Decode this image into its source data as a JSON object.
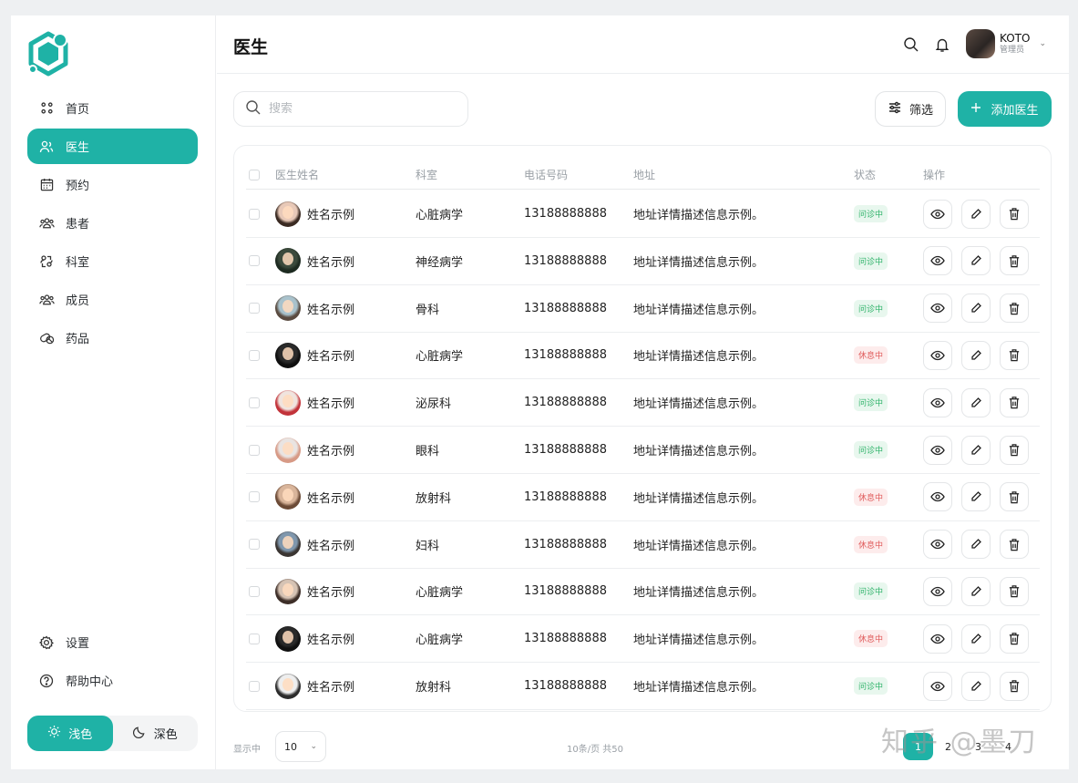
{
  "colors": {
    "accent": "#1fb2a6",
    "status_ok": "#2fb36a",
    "status_rest": "#e05a5a"
  },
  "sidebar": {
    "logo_icon": "hexagon-logo-icon",
    "items": [
      {
        "label": "首页",
        "icon": "grid-dots-icon",
        "active": false
      },
      {
        "label": "医生",
        "icon": "users-icon",
        "active": true
      },
      {
        "label": "预约",
        "icon": "calendar-icon",
        "active": false
      },
      {
        "label": "患者",
        "icon": "group-icon",
        "active": false
      },
      {
        "label": "科室",
        "icon": "refresh-people-icon",
        "active": false
      },
      {
        "label": "成员",
        "icon": "group-icon",
        "active": false
      },
      {
        "label": "药品",
        "icon": "pill-icon",
        "active": false
      }
    ],
    "bottom": [
      {
        "label": "设置",
        "icon": "gear-icon"
      },
      {
        "label": "帮助中心",
        "icon": "help-icon"
      }
    ],
    "theme": {
      "light": "浅色",
      "dark": "深色"
    }
  },
  "header": {
    "title": "医生",
    "user": {
      "name": "KOTO",
      "role": "管理员"
    }
  },
  "toolbar": {
    "search_placeholder": "搜索",
    "filter_label": "筛选",
    "add_label": "添加医生"
  },
  "table": {
    "columns": {
      "name": "医生姓名",
      "dept": "科室",
      "phone": "电话号码",
      "address": "地址",
      "status": "状态",
      "ops": "操作"
    },
    "rows": [
      {
        "name": "姓名示例",
        "dept": "心脏病学",
        "phone": "13188888888",
        "address": "地址详情描述信息示例。",
        "status": "问诊中",
        "status_type": "ok",
        "avatar": [
          "#e8c9b8",
          "#3a2a22"
        ]
      },
      {
        "name": "姓名示例",
        "dept": "神经病学",
        "phone": "13188888888",
        "address": "地址详情描述信息示例。",
        "status": "问诊中",
        "status_type": "ok",
        "avatar": [
          "#3b4a3c",
          "#1d2a20"
        ]
      },
      {
        "name": "姓名示例",
        "dept": "骨科",
        "phone": "13188888888",
        "address": "地址详情描述信息示例。",
        "status": "问诊中",
        "status_type": "ok",
        "avatar": [
          "#a9c2cc",
          "#5a4b40"
        ]
      },
      {
        "name": "姓名示例",
        "dept": "心脏病学",
        "phone": "13188888888",
        "address": "地址详情描述信息示例。",
        "status": "休息中",
        "status_type": "rest",
        "avatar": [
          "#2a2a2a",
          "#0f0f0f"
        ]
      },
      {
        "name": "姓名示例",
        "dept": "泌尿科",
        "phone": "13188888888",
        "address": "地址详情描述信息示例。",
        "status": "问诊中",
        "status_type": "ok",
        "avatar": [
          "#f0e4de",
          "#c2333a"
        ]
      },
      {
        "name": "姓名示例",
        "dept": "眼科",
        "phone": "13188888888",
        "address": "地址详情描述信息示例。",
        "status": "问诊中",
        "status_type": "ok",
        "avatar": [
          "#e9e4e2",
          "#d79a86"
        ]
      },
      {
        "name": "姓名示例",
        "dept": "放射科",
        "phone": "13188888888",
        "address": "地址详情描述信息示例。",
        "status": "休息中",
        "status_type": "rest",
        "avatar": [
          "#d9b59b",
          "#6b4a36"
        ]
      },
      {
        "name": "姓名示例",
        "dept": "妇科",
        "phone": "13188888888",
        "address": "地址详情描述信息示例。",
        "status": "休息中",
        "status_type": "rest",
        "avatar": [
          "#7f97ad",
          "#3a3532"
        ]
      },
      {
        "name": "姓名示例",
        "dept": "心脏病学",
        "phone": "13188888888",
        "address": "地址详情描述信息示例。",
        "status": "问诊中",
        "status_type": "ok",
        "avatar": [
          "#d6c3b4",
          "#3d2e28"
        ]
      },
      {
        "name": "姓名示例",
        "dept": "心脏病学",
        "phone": "13188888888",
        "address": "地址详情描述信息示例。",
        "status": "休息中",
        "status_type": "rest",
        "avatar": [
          "#2a2a2a",
          "#101010"
        ]
      },
      {
        "name": "姓名示例",
        "dept": "放射科",
        "phone": "13188888888",
        "address": "地址详情描述信息示例。",
        "status": "问诊中",
        "status_type": "ok",
        "avatar": [
          "#eeeeee",
          "#2c2c2c"
        ]
      }
    ],
    "op_icons": [
      "eye-icon",
      "pencil-icon",
      "trash-icon"
    ]
  },
  "footer": {
    "show_label": "显示中",
    "page_size": "10",
    "page_info": "10条/页  共50",
    "pages": [
      "1",
      "2",
      "3",
      "4"
    ],
    "current_page": "1"
  },
  "watermark": "知乎 @墨刀"
}
